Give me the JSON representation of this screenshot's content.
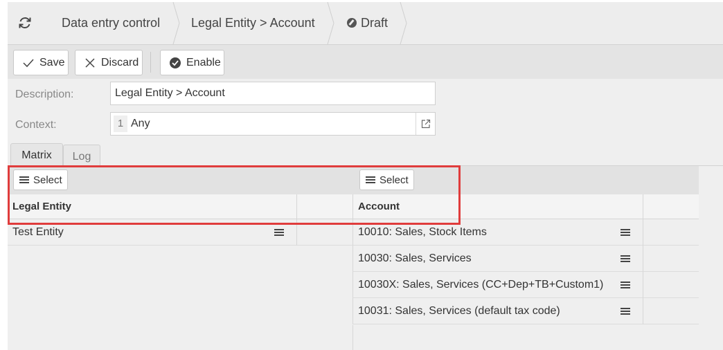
{
  "header": {
    "refresh_icon": "refresh-icon",
    "crumbs": [
      "Data entry control",
      "Legal Entity > Account",
      "Draft"
    ],
    "draft_icon": "draft-status-icon"
  },
  "toolbar": {
    "save_label": "Save",
    "discard_label": "Discard",
    "enable_label": "Enable"
  },
  "form": {
    "description_label": "Description:",
    "description_value": "Legal Entity > Account",
    "context_label": "Context:",
    "context_count": "1",
    "context_value": "Any"
  },
  "tabs": [
    {
      "label": "Matrix",
      "active": true
    },
    {
      "label": "Log",
      "active": false
    }
  ],
  "matrix": {
    "select_label": "Select",
    "left": {
      "header": "Legal Entity",
      "rows": [
        "Test Entity"
      ]
    },
    "right": {
      "header": "Account",
      "rows": [
        "10010: Sales, Stock Items",
        "10030: Sales, Services",
        "10030X: Sales, Services (CC+Dep+TB+Custom1)",
        "10031: Sales, Services (default tax code)"
      ]
    }
  },
  "colors": {
    "highlight": "#e03c3c",
    "background": "#efefef"
  }
}
